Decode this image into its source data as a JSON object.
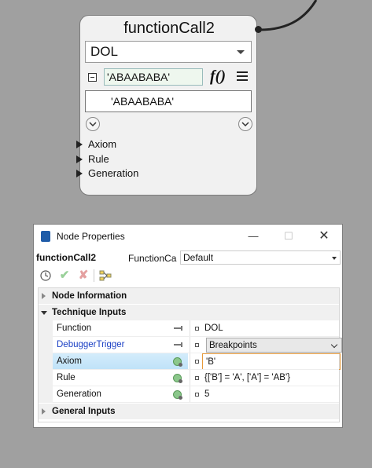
{
  "node": {
    "title": "functionCall2",
    "function_select": "DOL",
    "string_value": "'ABAABABA'",
    "fx_label": "f()",
    "display_value": "'ABAABABA'",
    "ports": [
      "Axiom",
      "Rule",
      "Generation"
    ]
  },
  "window": {
    "title": "Node Properties",
    "minimize": "—",
    "maximize": "☐",
    "close": "✕",
    "node_name": "functionCall2",
    "function_call_label": "FunctionCa",
    "function_call_value": "Default",
    "sections": {
      "node_information": "Node Information",
      "technique_inputs": "Technique Inputs",
      "general_inputs": "General Inputs"
    },
    "properties": [
      {
        "name": "Function",
        "value": "DOL"
      },
      {
        "name": "DebuggerTrigger",
        "value": "Breakpoints"
      },
      {
        "name": "Axiom",
        "value": "'B'"
      },
      {
        "name": "Rule",
        "value": "{['B'] = 'A', ['A'] = 'AB'}"
      },
      {
        "name": "Generation",
        "value": "5"
      }
    ]
  },
  "colors": {
    "background": "#a0a0a0",
    "debugger_link": "#1a3fc4",
    "selected_row": "#c6e6fa",
    "edit_border": "#e79a3a"
  }
}
